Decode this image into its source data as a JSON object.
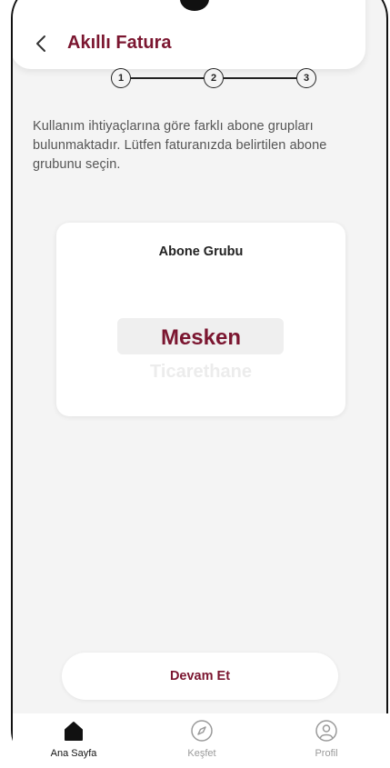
{
  "header": {
    "title": "Akıllı Fatura",
    "back_icon": "chevron-left-icon"
  },
  "stepper": {
    "steps": [
      "1",
      "2",
      "3"
    ]
  },
  "description": "Kullanım ihtiyaçlarına göre farklı abone grupları bulunmaktadır. Lütfen faturanızda belirtilen abone grubunu seçin.",
  "picker": {
    "title": "Abone Grubu",
    "selected": "Mesken",
    "next_option": "Ticarethane"
  },
  "continue_button": {
    "label": "Devam Et"
  },
  "bottom_nav": {
    "items": [
      {
        "label": "Ana Sayfa",
        "icon": "home-icon",
        "active": true
      },
      {
        "label": "Keşfet",
        "icon": "compass-icon",
        "active": false
      },
      {
        "label": "Profil",
        "icon": "profile-icon",
        "active": false
      }
    ]
  },
  "colors": {
    "brand": "#7b1630",
    "background": "#f4f4f4",
    "inactive": "#9a9a9a"
  }
}
